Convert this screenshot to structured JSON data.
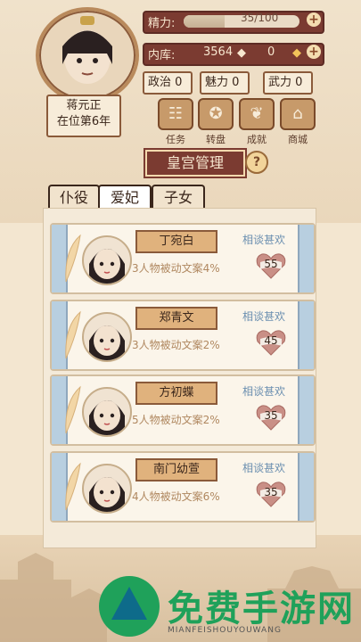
{
  "player": {
    "name": "蒋元正",
    "reign": "在位第6年"
  },
  "stats": {
    "energy_label": "精力:",
    "energy_text": "35/100",
    "energy_fraction": 0.35,
    "treasury_label": "内库:",
    "treasury_value": "3564",
    "gold_value": "0",
    "politics": "政治 0",
    "charm": "魅力 0",
    "force": "武力 0"
  },
  "menu": [
    {
      "label": "任务",
      "icon": "scroll-icon"
    },
    {
      "label": "转盘",
      "icon": "wheel-icon"
    },
    {
      "label": "成就",
      "icon": "trophy-icon"
    },
    {
      "label": "商城",
      "icon": "shop-icon"
    }
  ],
  "page_title": "皇宫管理",
  "help": "?",
  "tabs": [
    {
      "label": "仆役",
      "active": false
    },
    {
      "label": "爱妃",
      "active": true
    },
    {
      "label": "子女",
      "active": false
    }
  ],
  "consorts": [
    {
      "name": "丁宛白",
      "effect": "3人物被动文案4%",
      "relation": "相谈甚欢",
      "favor": "55"
    },
    {
      "name": "郑青文",
      "effect": "3人物被动文案2%",
      "relation": "相谈甚欢",
      "favor": "45"
    },
    {
      "name": "方初蝶",
      "effect": "5人物被动文案2%",
      "relation": "相谈甚欢",
      "favor": "35"
    },
    {
      "name": "南门幼萱",
      "effect": "4人物被动文案6%",
      "relation": "相谈甚欢",
      "favor": "35"
    }
  ],
  "watermark": {
    "title": "免费手游网",
    "sub": "MIANFEISHOUYOUWANG"
  },
  "colors": {
    "accent": "#7b3b31",
    "relation": "#6b8fb0",
    "watermark": "#1fa15a"
  }
}
